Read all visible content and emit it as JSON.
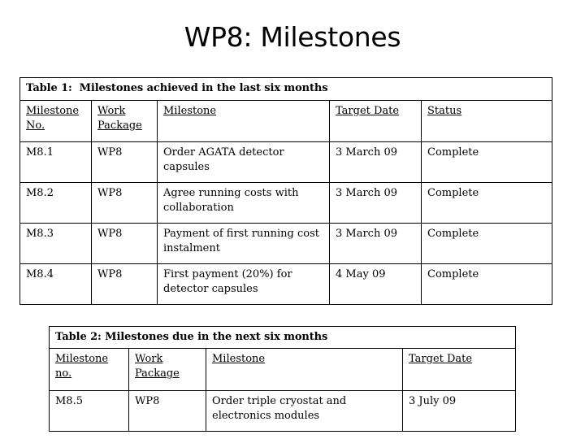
{
  "slide": {
    "title": "WP8: Milestones"
  },
  "table1": {
    "caption": "Table 1:  Milestones achieved in the last six months",
    "headers": [
      "Milestone No.",
      "Work Package",
      "Milestone",
      "Target Date",
      "Status"
    ],
    "header_lines": [
      [
        "Milestone",
        "No."
      ],
      [
        "Work",
        "Package"
      ],
      [
        "Milestone"
      ],
      [
        "Target Date"
      ],
      [
        "Status"
      ]
    ],
    "rows": [
      {
        "milestone_no": "M8.1",
        "work_package": "WP8",
        "milestone": "Order AGATA detector capsules",
        "target_date": "3 March 09",
        "status": "Complete"
      },
      {
        "milestone_no": "M8.2",
        "work_package": "WP8",
        "milestone": "Agree running costs with collaboration",
        "target_date": "3 March 09",
        "status": "Complete"
      },
      {
        "milestone_no": "M8.3",
        "work_package": "WP8",
        "milestone": "Payment of first running cost instalment",
        "target_date": "3 March 09",
        "status": "Complete"
      },
      {
        "milestone_no": "M8.4",
        "work_package": "WP8",
        "milestone": "First payment (20%) for detector capsules",
        "target_date": "4 May 09",
        "status": "Complete"
      }
    ]
  },
  "table2": {
    "caption": "Table 2: Milestones due in the next six months",
    "headers": [
      "Milestone no.",
      "Work Package",
      "Milestone",
      "Target Date"
    ],
    "header_lines": [
      [
        "Milestone",
        "no."
      ],
      [
        "Work",
        "Package"
      ],
      [
        "Milestone"
      ],
      [
        "Target Date"
      ]
    ],
    "rows": [
      {
        "milestone_no": "M8.5",
        "work_package": "WP8",
        "milestone": "Order triple cryostat and electronics modules",
        "target_date": "3 July 09"
      }
    ]
  },
  "colors": {
    "page_background": "#ffffff",
    "text": "#000000",
    "table_border": "#000000"
  }
}
